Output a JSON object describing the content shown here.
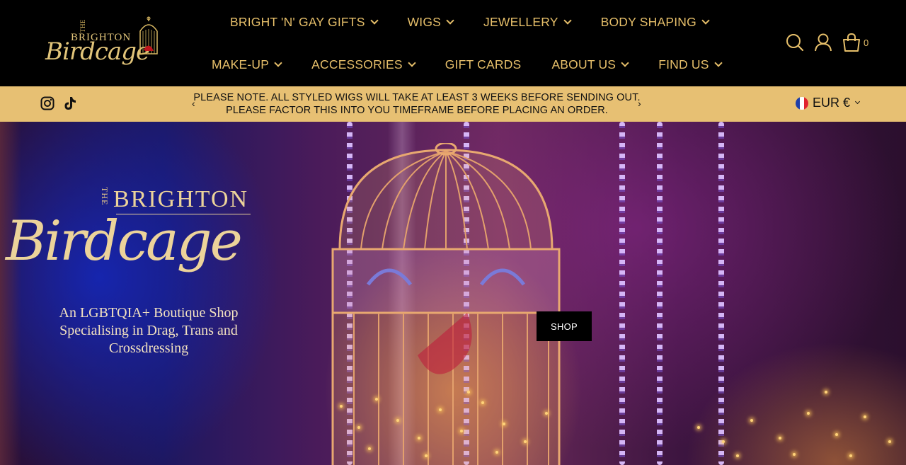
{
  "header": {
    "logo": {
      "the": "THE",
      "brighton": "BRIGHTON",
      "birdcage": "Birdcage"
    },
    "nav_row1": [
      {
        "label": "BRIGHT 'N' GAY GIFTS",
        "dropdown": true
      },
      {
        "label": "WIGS",
        "dropdown": true
      },
      {
        "label": "JEWELLERY",
        "dropdown": true
      },
      {
        "label": "BODY SHAPING",
        "dropdown": true
      }
    ],
    "nav_row2": [
      {
        "label": "MAKE-UP",
        "dropdown": true
      },
      {
        "label": "ACCESSORIES",
        "dropdown": true
      },
      {
        "label": "GIFT CARDS",
        "dropdown": false
      },
      {
        "label": "ABOUT US",
        "dropdown": true
      },
      {
        "label": "FIND US",
        "dropdown": true
      }
    ],
    "icons": [
      "search-icon",
      "account-icon",
      "cart-icon"
    ],
    "cart_count": "0"
  },
  "announcement": {
    "line1": "PLEASE NOTE. ALL STYLED WIGS WILL TAKE AT LEAST 3 WEEKS BEFORE SENDING OUT.",
    "line2": "PLEASE FACTOR THIS INTO YOU TIMEFRAME BEFORE PLACING AN ORDER.",
    "prev": "‹",
    "next": "›",
    "social": [
      "instagram-icon",
      "tiktok-icon"
    ],
    "currency": "EUR €"
  },
  "hero": {
    "logo": {
      "the": "THE",
      "brighton": "BRIGHTON",
      "birdcage": "Birdcage"
    },
    "tagline_line1": "An LGBTQIA+ Boutique Shop",
    "tagline_line2": "Specialising in Drag, Trans and",
    "tagline_line3": "Crossdressing",
    "cta": "SHOP"
  },
  "colors": {
    "header_bg": "#000000",
    "gold": "#e6bf6a",
    "announcement_bg": "#e7c073",
    "button_bg": "#000000"
  }
}
